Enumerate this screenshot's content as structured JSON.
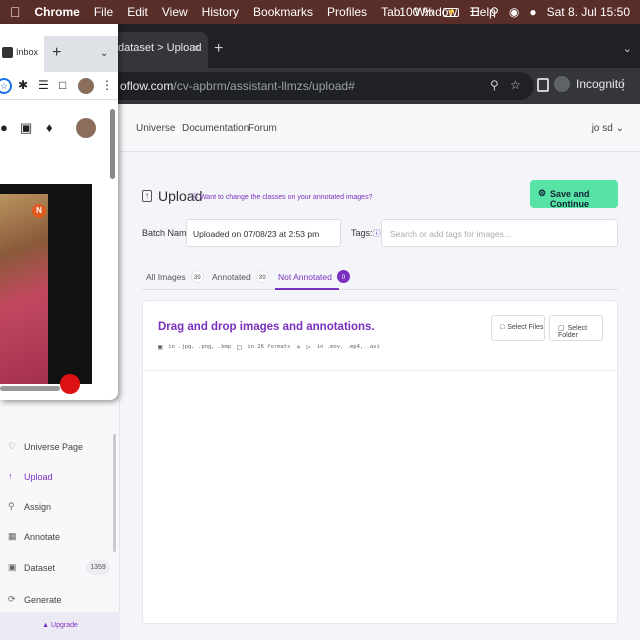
{
  "menubar": {
    "apple": "",
    "items": [
      "Chrome",
      "File",
      "Edit",
      "View",
      "History",
      "Bookmarks",
      "Profiles",
      "Tab",
      "Window",
      "Help"
    ],
    "battery": "100 %",
    "datetime": "Sat 8. Jul  15:50"
  },
  "browser": {
    "active_tab_title": "dataset > Upload",
    "tab_close": "×",
    "new_tab": "+",
    "url_host": "oflow.com",
    "url_path": "/cv-apbrm/assistant-llmzs/upload#",
    "profile_label": "Incognito"
  },
  "side_window": {
    "tab_title": "Inbox",
    "new_tab": "+",
    "channel_logo": "N"
  },
  "topnav": {
    "links": [
      "Universe",
      "Documentation",
      "Forum"
    ],
    "user": "jo sd"
  },
  "upload": {
    "title": "Upload",
    "hint": "Want to change the classes on your annotated images?",
    "save_button": "Save and Continue",
    "batch_label": "Batch Name:",
    "batch_value": "Uploaded on 07/08/23 at 2:53 pm",
    "tags_label": "Tags:",
    "tags_placeholder": "Search or add tags for images...",
    "tabs": [
      {
        "label": "All Images",
        "count": "39"
      },
      {
        "label": "Annotated",
        "count": "39"
      },
      {
        "label": "Not Annotated",
        "count": "0"
      }
    ],
    "dropzone": {
      "title": "Drag and drop images and annotations.",
      "images_formats": "in .jpg, .png, .bmp",
      "annotation_formats": "in 26 formats",
      "formats_arrow": "»",
      "video_formats": "in .mov, .mp4, .avi",
      "select_files": "Select Files",
      "select_folder": "Select Folder"
    }
  },
  "sidebar": {
    "items": [
      {
        "label": "Universe Page"
      },
      {
        "label": "Upload"
      },
      {
        "label": "Assign"
      },
      {
        "label": "Annotate"
      },
      {
        "label": "Dataset",
        "badge": "1359"
      },
      {
        "label": "Generate"
      }
    ],
    "upgrade": "Upgrade"
  },
  "colors": {
    "accent": "#7b2fbf",
    "save_button": "#57e3a6",
    "menubar": "#5a2e28"
  }
}
